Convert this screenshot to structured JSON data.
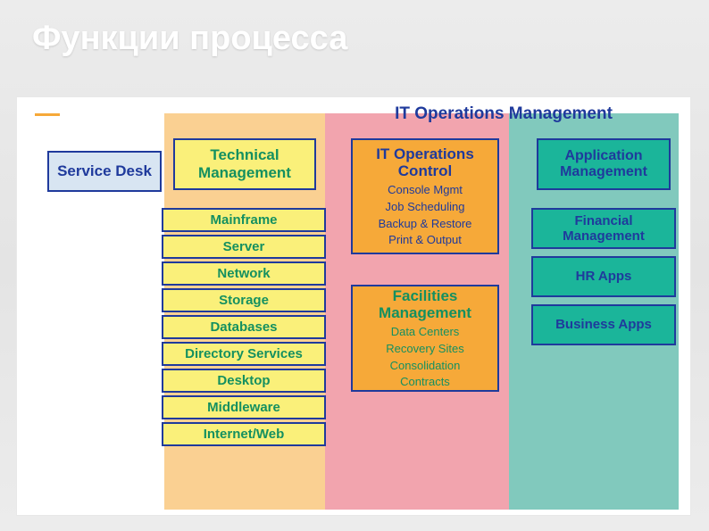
{
  "slide": {
    "title": "Функции процесса"
  },
  "diagram": {
    "header": "IT Operations Management",
    "service_desk": "Service Desk",
    "technical": {
      "title": "Technical Management",
      "items": [
        "Mainframe",
        "Server",
        "Network",
        "Storage",
        "Databases",
        "Directory Services",
        "Desktop",
        "Middleware",
        "Internet/Web"
      ]
    },
    "ops_control": {
      "title": "IT Operations Control",
      "subs": [
        "Console Mgmt",
        "Job Scheduling",
        "Backup & Restore",
        "Print & Output"
      ]
    },
    "facilities": {
      "title": "Facilities Management",
      "subs": [
        "Data Centers",
        "Recovery Sites",
        "Consolidation",
        "Contracts"
      ]
    },
    "application": {
      "title": "Application Management",
      "items": [
        "Financial Management",
        "HR Apps",
        "Business Apps"
      ]
    }
  },
  "colors": {
    "blue": "#1f3a9c",
    "green": "#149060",
    "yellow": "#faf07a",
    "orange": "#f6a939",
    "teal": "#1bb59a",
    "pink": "#e85a6c"
  }
}
